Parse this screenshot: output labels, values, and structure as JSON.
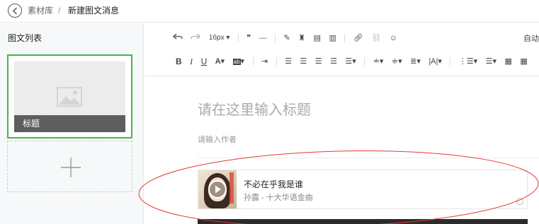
{
  "breadcrumb": {
    "root": "素材库",
    "separator": "/",
    "current": "新建图文消息"
  },
  "left_panel": {
    "title": "图文列表",
    "cards": [
      {
        "caption": "标题"
      }
    ]
  },
  "toolbar": {
    "font_size": "16px",
    "right_label": "自动"
  },
  "editor": {
    "title_placeholder": "请在这里输入标题",
    "author_placeholder": "请输入作者",
    "music": {
      "title": "不必在乎我是谁",
      "subtitle": "孙露 - 十大华语金曲"
    }
  },
  "colors": {
    "selection_border": "#44b549",
    "annotation": "#e53935"
  },
  "annotation": {
    "shape": "ellipse",
    "color": "#e53935",
    "target": "music-card"
  }
}
